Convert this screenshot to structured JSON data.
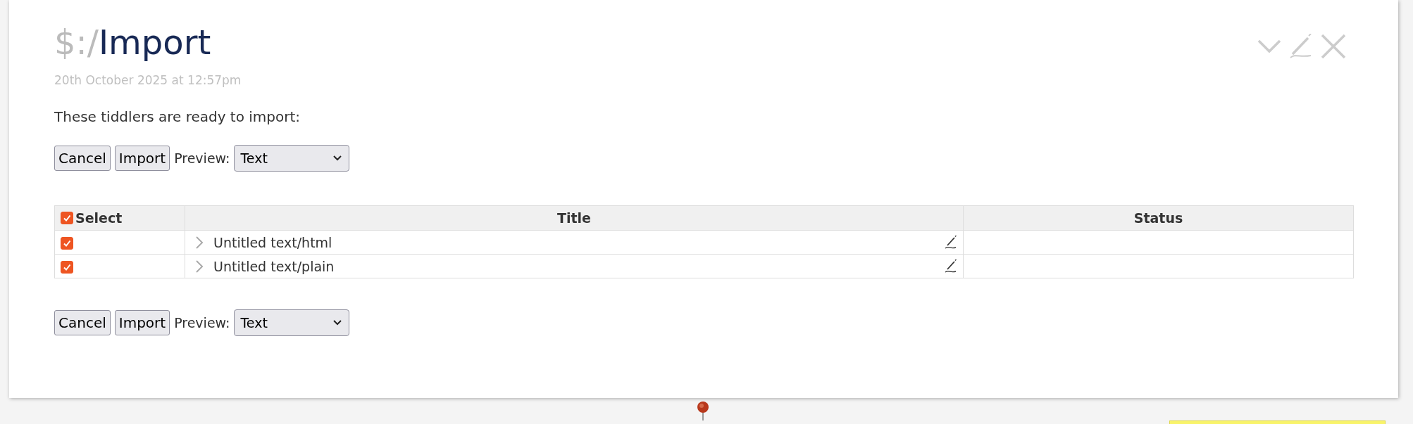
{
  "tiddler": {
    "title_prefix": "$:/",
    "title": "Import",
    "modified": "20th October 2025 at 12:57pm",
    "intro": "These tiddlers are ready to import:",
    "toolbars": [
      {
        "buttons": [
          "Cancel",
          "Import"
        ],
        "preview_label": "Preview:",
        "preview_value": "Text"
      },
      {
        "buttons": [
          "Cancel",
          "Import"
        ],
        "preview_label": "Preview:",
        "preview_value": "Text"
      }
    ],
    "table": {
      "columns": [
        {
          "label": "Select",
          "kind": "checkbox",
          "checked": true
        },
        {
          "label": "Title",
          "kind": "text"
        },
        {
          "label": "Status",
          "kind": "text"
        }
      ],
      "rows": [
        {
          "checked": true,
          "title": "Untitled text/html",
          "expanded": false
        },
        {
          "checked": true,
          "title": "Untitled text/plain",
          "expanded": false
        }
      ]
    }
  }
}
